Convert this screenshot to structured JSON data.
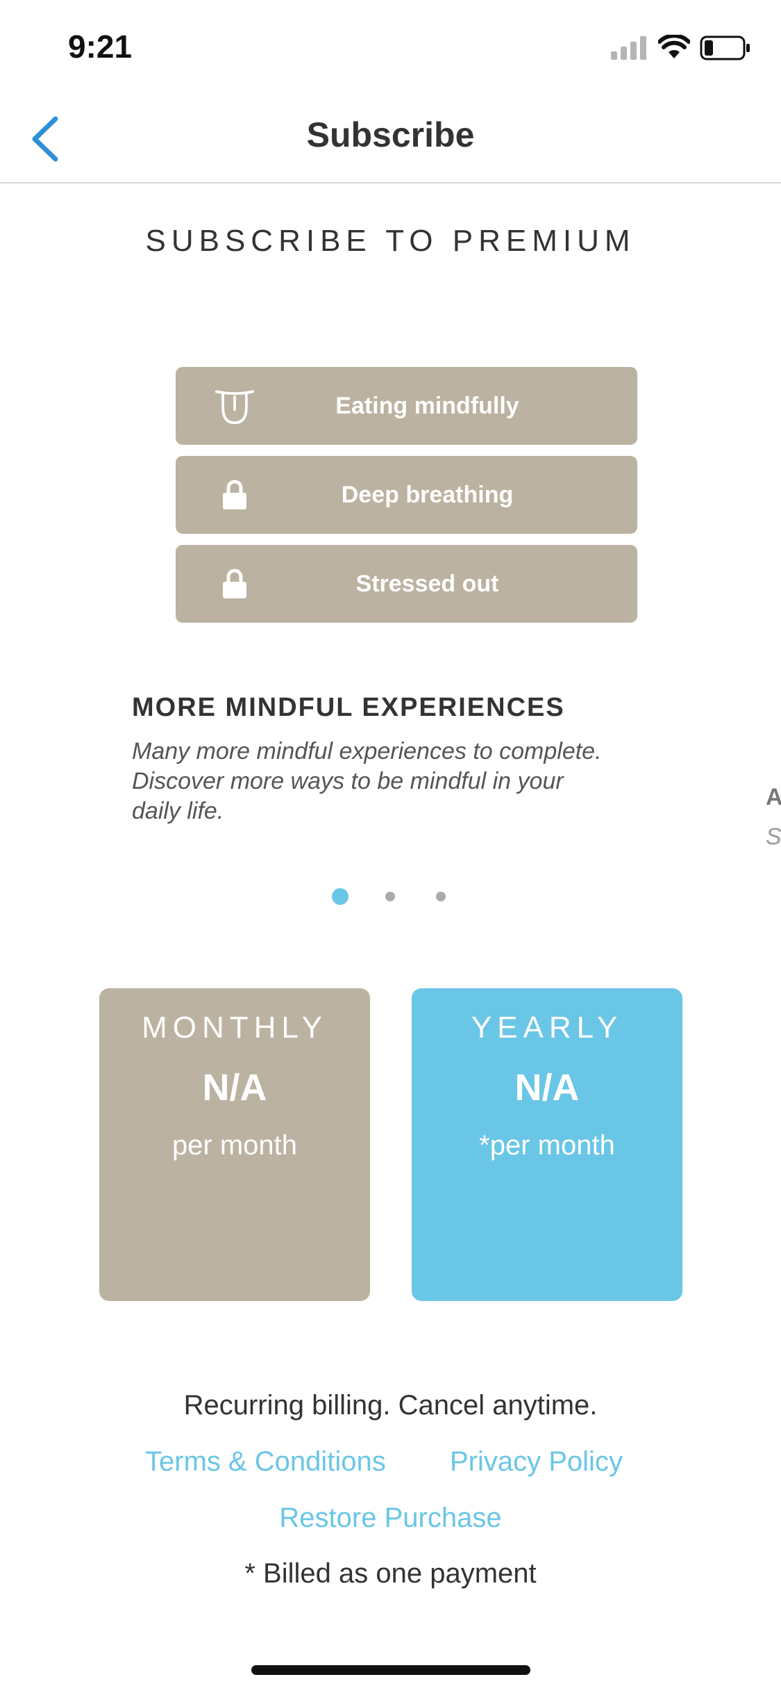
{
  "status_bar": {
    "time": "9:21",
    "icons": [
      "cellular-signal-icon",
      "wifi-icon",
      "battery-icon"
    ]
  },
  "nav": {
    "back_icon": "chevron-left-icon",
    "title": "Subscribe"
  },
  "page_title": "SUBSCRIBE TO PREMIUM",
  "features": [
    {
      "label": "Eating mindfully",
      "icon": "tongue-face-icon",
      "locked": false
    },
    {
      "label": "Deep breathing",
      "icon": "lock-icon",
      "locked": true
    },
    {
      "label": "Stressed out",
      "icon": "lock-icon",
      "locked": true
    }
  ],
  "carousel": {
    "heading": "MORE MINDFUL EXPERIENCES",
    "description": "Many more mindful experiences to complete. Discover more ways to be mindful in your daily life.",
    "next_peek_heading": "A",
    "next_peek_desc": "S",
    "page_count": 3,
    "active_page": 1
  },
  "plans": [
    {
      "name": "MONTHLY",
      "price": "N/A",
      "period": "per month",
      "color": "#bbb2a1"
    },
    {
      "name": "YEARLY",
      "price": "N/A",
      "period": "*per month",
      "color": "#6ac6e6"
    }
  ],
  "footer": {
    "billing_note": "Recurring billing. Cancel anytime.",
    "terms_link": "Terms & Conditions",
    "privacy_link": "Privacy Policy",
    "restore_link": "Restore Purchase",
    "billed_note": "* Billed as one payment"
  },
  "colors": {
    "accent": "#6ac6e6",
    "back_blue": "#2f8fd8",
    "feature_bg": "#bbb2a1"
  }
}
